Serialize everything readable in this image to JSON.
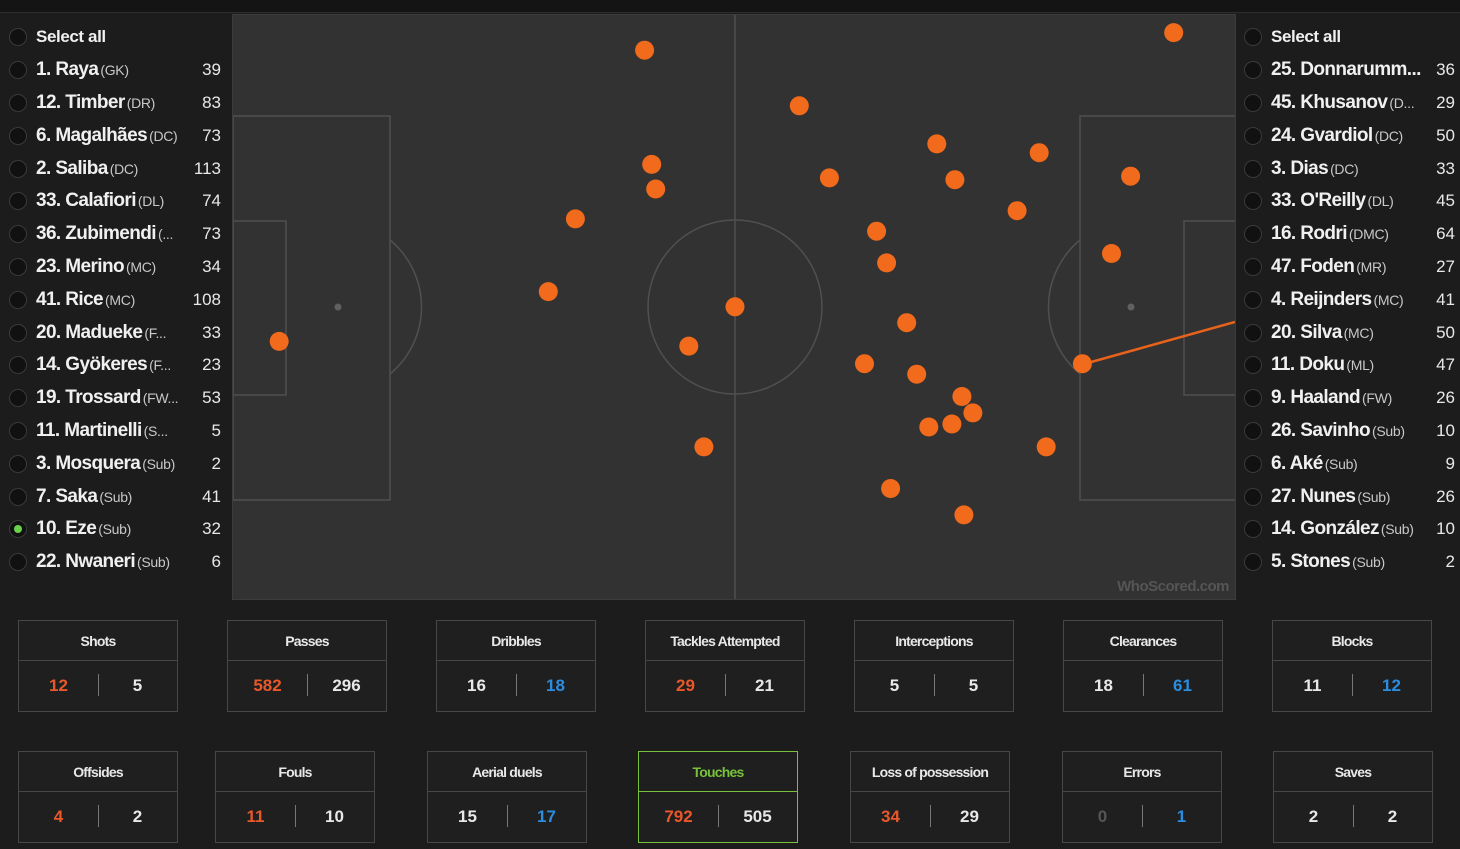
{
  "home_team": {
    "select_all_label": "Select all",
    "players": [
      {
        "name": "1. Raya",
        "pos": "(GK)",
        "count": "39"
      },
      {
        "name": "12. Timber",
        "pos": "(DR)",
        "count": "83"
      },
      {
        "name": "6. Magalhães",
        "pos": "(DC)",
        "count": "73"
      },
      {
        "name": "2. Saliba",
        "pos": "(DC)",
        "count": "113"
      },
      {
        "name": "33. Calafiori",
        "pos": "(DL)",
        "count": "74"
      },
      {
        "name": "36. Zubimendi",
        "pos": "(...",
        "count": "73"
      },
      {
        "name": "23. Merino",
        "pos": "(MC)",
        "count": "34"
      },
      {
        "name": "41. Rice",
        "pos": "(MC)",
        "count": "108"
      },
      {
        "name": "20. Madueke",
        "pos": "(F...",
        "count": "33"
      },
      {
        "name": "14. Gyökeres",
        "pos": "(F...",
        "count": "23"
      },
      {
        "name": "19. Trossard",
        "pos": "(FW...",
        "count": "53"
      },
      {
        "name": "11. Martinelli",
        "pos": "(S...",
        "count": "5"
      },
      {
        "name": "3. Mosquera",
        "pos": "(Sub)",
        "count": "2"
      },
      {
        "name": "7. Saka",
        "pos": "(Sub)",
        "count": "41"
      },
      {
        "name": "10. Eze",
        "pos": "(Sub)",
        "count": "32",
        "selected": true
      },
      {
        "name": "22. Nwaneri",
        "pos": "(Sub)",
        "count": "6"
      }
    ]
  },
  "away_team": {
    "select_all_label": "Select all",
    "players": [
      {
        "name": "25. Donnarumm...",
        "pos": "",
        "count": "36"
      },
      {
        "name": "45. Khusanov",
        "pos": "(D...",
        "count": "29"
      },
      {
        "name": "24. Gvardiol",
        "pos": "(DC)",
        "count": "50"
      },
      {
        "name": "3. Dias",
        "pos": "(DC)",
        "count": "33"
      },
      {
        "name": "33. O'Reilly",
        "pos": "(DL)",
        "count": "45"
      },
      {
        "name": "16. Rodri",
        "pos": "(DMC)",
        "count": "64"
      },
      {
        "name": "47. Foden",
        "pos": "(MR)",
        "count": "27"
      },
      {
        "name": "4. Reijnders",
        "pos": "(MC)",
        "count": "41"
      },
      {
        "name": "20. Silva",
        "pos": "(MC)",
        "count": "50"
      },
      {
        "name": "11. Doku",
        "pos": "(ML)",
        "count": "47"
      },
      {
        "name": "9. Haaland",
        "pos": "(FW)",
        "count": "26"
      },
      {
        "name": "26. Savinho",
        "pos": "(Sub)",
        "count": "10"
      },
      {
        "name": "6. Aké",
        "pos": "(Sub)",
        "count": "9"
      },
      {
        "name": "27. Nunes",
        "pos": "(Sub)",
        "count": "26"
      },
      {
        "name": "14. González",
        "pos": "(Sub)",
        "count": "10"
      },
      {
        "name": "5. Stones",
        "pos": "(Sub)",
        "count": "2"
      }
    ]
  },
  "pitch": {
    "watermark": "WhoScored.com",
    "touch_color": "#f26a1b",
    "touches": [
      [
        0.937,
        0.03
      ],
      [
        0.41,
        0.06
      ],
      [
        0.564,
        0.155
      ],
      [
        0.701,
        0.22
      ],
      [
        0.803,
        0.235
      ],
      [
        0.417,
        0.255
      ],
      [
        0.894,
        0.275
      ],
      [
        0.594,
        0.278
      ],
      [
        0.719,
        0.281
      ],
      [
        0.421,
        0.297
      ],
      [
        0.781,
        0.334
      ],
      [
        0.341,
        0.348
      ],
      [
        0.641,
        0.369
      ],
      [
        0.651,
        0.423
      ],
      [
        0.875,
        0.407
      ],
      [
        0.314,
        0.472
      ],
      [
        0.046,
        0.557
      ],
      [
        0.5,
        0.498
      ],
      [
        0.671,
        0.525
      ],
      [
        0.454,
        0.565
      ],
      [
        0.629,
        0.595
      ],
      [
        0.846,
        0.595
      ],
      [
        0.681,
        0.613
      ],
      [
        0.726,
        0.651
      ],
      [
        0.737,
        0.679
      ],
      [
        0.716,
        0.698
      ],
      [
        0.693,
        0.703
      ],
      [
        0.469,
        0.737
      ],
      [
        0.81,
        0.737
      ],
      [
        0.655,
        0.808
      ],
      [
        0.728,
        0.853
      ]
    ]
  },
  "stats": [
    {
      "label": "Shots",
      "home": "12",
      "away": "5",
      "home_color": "orange",
      "away_color": "white"
    },
    {
      "label": "Passes",
      "home": "582",
      "away": "296",
      "home_color": "orange",
      "away_color": "white"
    },
    {
      "label": "Dribbles",
      "home": "16",
      "away": "18",
      "home_color": "white",
      "away_color": "blue"
    },
    {
      "label": "Tackles Attempted",
      "home": "29",
      "away": "21",
      "home_color": "orange",
      "away_color": "white"
    },
    {
      "label": "Interceptions",
      "home": "5",
      "away": "5",
      "home_color": "white",
      "away_color": "white"
    },
    {
      "label": "Clearances",
      "home": "18",
      "away": "61",
      "home_color": "white",
      "away_color": "blue"
    },
    {
      "label": "Blocks",
      "home": "11",
      "away": "12",
      "home_color": "white",
      "away_color": "blue"
    },
    {
      "label": "Offsides",
      "home": "4",
      "away": "2",
      "home_color": "orange",
      "away_color": "white"
    },
    {
      "label": "Fouls",
      "home": "11",
      "away": "10",
      "home_color": "orange",
      "away_color": "white"
    },
    {
      "label": "Aerial duels",
      "home": "15",
      "away": "17",
      "home_color": "white",
      "away_color": "blue"
    },
    {
      "label": "Touches",
      "home": "792",
      "away": "505",
      "home_color": "orange",
      "away_color": "white",
      "active": true
    },
    {
      "label": "Loss of possession",
      "home": "34",
      "away": "29",
      "home_color": "orange",
      "away_color": "white"
    },
    {
      "label": "Errors",
      "home": "0",
      "away": "1",
      "home_color": "grey",
      "away_color": "blue"
    },
    {
      "label": "Saves",
      "home": "2",
      "away": "2",
      "home_color": "white",
      "away_color": "white"
    }
  ]
}
